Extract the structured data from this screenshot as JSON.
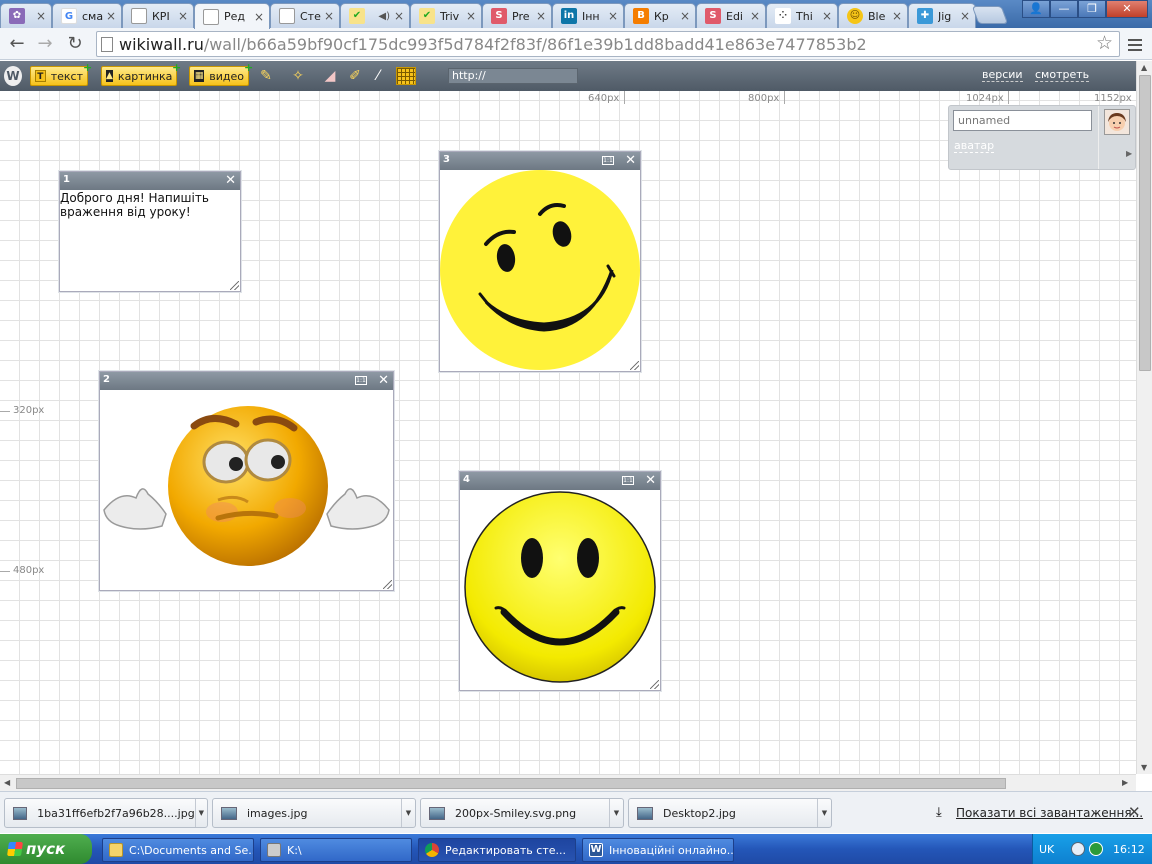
{
  "browser": {
    "tabs": [
      {
        "label": "",
        "fav": "#8a6ab8",
        "icon": "flower-icon"
      },
      {
        "label": "сма",
        "fav": "#4285f4",
        "icon": "google-icon"
      },
      {
        "label": "КРІ",
        "fav": "#999999",
        "icon": "page-icon"
      },
      {
        "label": "Ред",
        "fav": "#999999",
        "icon": "page-icon",
        "active": true
      },
      {
        "label": "Сте",
        "fav": "#999999",
        "icon": "page-icon"
      },
      {
        "label": "",
        "fav": "#d9b400",
        "icon": "checkmark-icon"
      },
      {
        "label": "Triv",
        "fav": "#d9b400",
        "icon": "checkmark-icon"
      },
      {
        "label": "Pre",
        "fav": "#e05a6a",
        "icon": "s-icon"
      },
      {
        "label": "Інн",
        "fav": "#0e76a8",
        "icon": "linkedin-icon"
      },
      {
        "label": "Кр",
        "fav": "#f57d00",
        "icon": "blogger-icon"
      },
      {
        "label": "Edi",
        "fav": "#e05a6a",
        "icon": "s-icon"
      },
      {
        "label": "Thi",
        "fav": "#444444",
        "icon": "dots-icon"
      },
      {
        "label": "Ble",
        "fav": "#f5c518",
        "icon": "smiley-icon"
      },
      {
        "label": "Jig",
        "fav": "#3b99d8",
        "icon": "puzzle-icon"
      }
    ],
    "url_host": "wikiwall.ru",
    "url_path": "/wall/b66a59bf90cf175dc993f5d784f2f83f/86f1e39b1dd8badd41e863e7477853b2"
  },
  "ww_toolbar": {
    "logo": "W",
    "text_btn": "текст",
    "image_btn": "картинка",
    "video_btn": "видео",
    "url_input": "http://",
    "versions_link": "версии",
    "view_link": "смотреть"
  },
  "ruler": {
    "x_labels": [
      "640px",
      "800px",
      "1024px",
      "1152px"
    ],
    "y_labels": [
      "320px",
      "480px"
    ]
  },
  "side_panel": {
    "name_value": "unnamed",
    "avatar_link": "аватар"
  },
  "widgets": {
    "w1": {
      "num": "1",
      "text": "Доброго дня! Напишіть\nвраження від уроку!"
    },
    "w2": {
      "num": "2",
      "ratio": "1:1"
    },
    "w3": {
      "num": "3",
      "ratio": "1:1"
    },
    "w4": {
      "num": "4",
      "ratio": "1:1"
    }
  },
  "downloads": {
    "items": [
      "1ba31ff6efb2f7a96b28....jpg",
      "images.jpg",
      "200px-Smiley.svg.png",
      "Desktop2.jpg"
    ],
    "show_all": "Показати всі завантаження..."
  },
  "taskbar": {
    "start": "пуск",
    "tasks": [
      "C:\\Documents and Se...",
      "K:\\",
      "Редактировать сте...",
      "Інноваційні онлайно..."
    ],
    "lang": "UK",
    "clock": "16:12"
  }
}
